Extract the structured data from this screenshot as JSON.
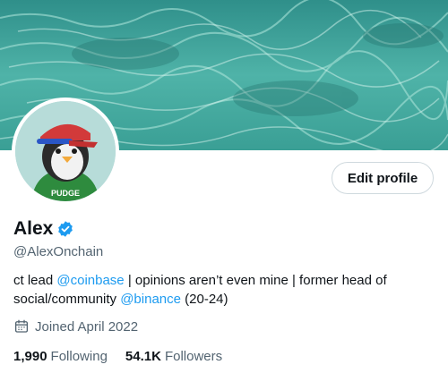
{
  "profile": {
    "edit_button": "Edit profile",
    "display_name": "Alex",
    "handle": "@AlexOnchain",
    "bio": {
      "part1": "ct lead ",
      "link1": "@coinbase",
      "part2": " | opinions aren’t even mine | former head of social/community ",
      "link2": "@binance",
      "part3": " (20-24)"
    },
    "joined": "Joined April 2022",
    "following_count": "1,990",
    "following_label": "Following",
    "followers_count": "54.1K",
    "followers_label": "Followers",
    "avatar_shirt_text": "PUDGE"
  },
  "icons": {
    "verified": "verified-badge-icon",
    "calendar": "calendar-icon"
  },
  "colors": {
    "accent": "#1d9bf0",
    "secondary_text": "#536471",
    "primary_text": "#0f1419"
  }
}
